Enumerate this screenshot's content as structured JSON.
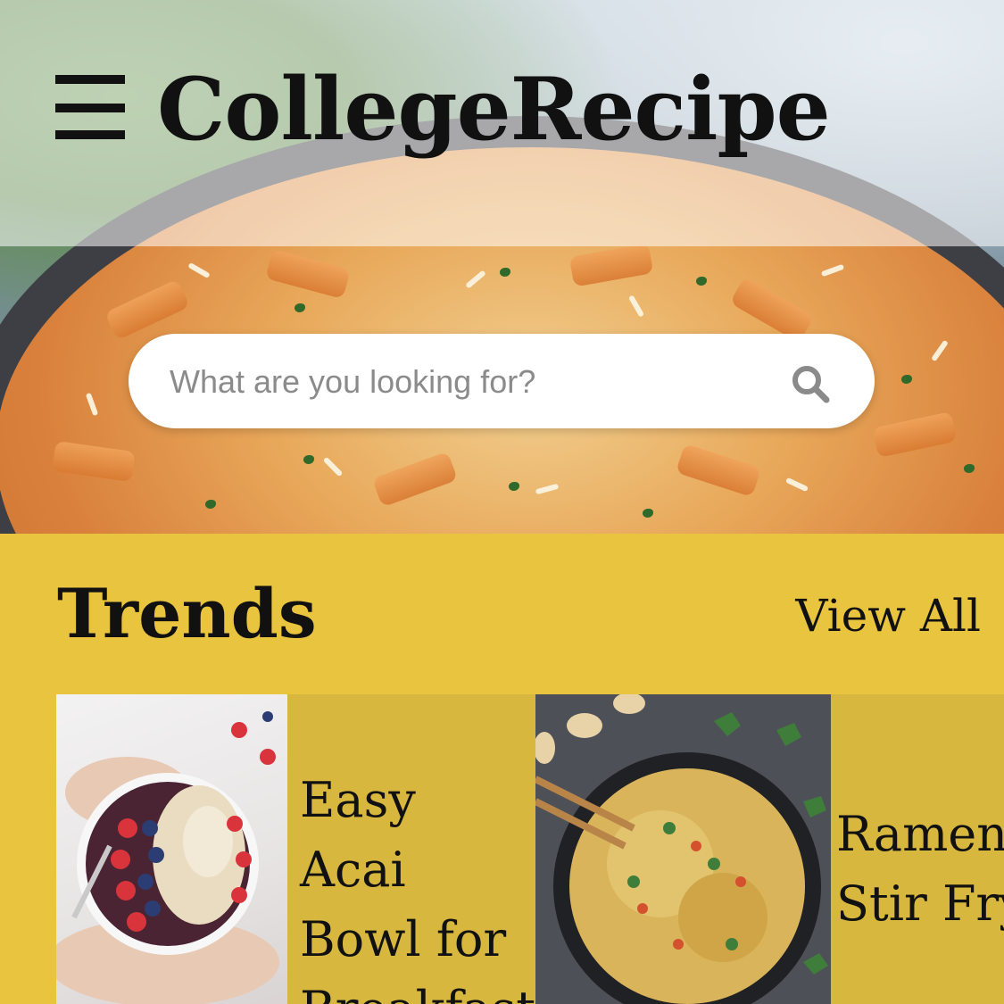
{
  "app": {
    "title": "CollegeRecipe"
  },
  "header": {
    "menu_icon": "hamburger-menu-icon"
  },
  "search": {
    "placeholder": "What are you looking for?",
    "value": "",
    "icon": "search-icon"
  },
  "trends": {
    "title": "Trends",
    "view_all_label": "View All",
    "cards": [
      {
        "title": "Easy Acai\nBowl for\nBreakfast",
        "image": "acai-bowl-photo"
      },
      {
        "title": "Ramen\nStir Fry",
        "image": "ramen-stir-fry-photo"
      }
    ]
  },
  "colors": {
    "section_background": "#e9c43e",
    "card_background": "#d7b73e",
    "text": "#111111",
    "search_background": "#ffffff"
  }
}
